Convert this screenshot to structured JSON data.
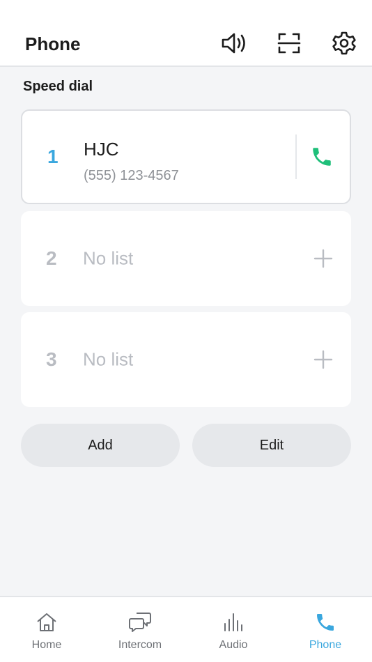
{
  "header": {
    "title": "Phone",
    "icons": [
      "speaker-icon",
      "scan-icon",
      "gear-icon"
    ]
  },
  "speed_dial": {
    "label": "Speed dial",
    "entries": [
      {
        "number": "1",
        "name": "HJC",
        "phone": "(555) 123-4567",
        "action_icon": "phone-icon"
      },
      {
        "number": "2",
        "empty_text": "No list",
        "action_icon": "plus-icon"
      },
      {
        "number": "3",
        "empty_text": "No list",
        "action_icon": "plus-icon"
      }
    ]
  },
  "actions": {
    "add_label": "Add",
    "edit_label": "Edit"
  },
  "bottom_nav": {
    "items": [
      {
        "label": "Home",
        "icon": "home-icon"
      },
      {
        "label": "Intercom",
        "icon": "chat-icon"
      },
      {
        "label": "Audio",
        "icon": "audio-bars-icon"
      },
      {
        "label": "Phone",
        "icon": "phone-icon",
        "active": true
      }
    ]
  },
  "colors": {
    "accent": "#3aa7de",
    "call_green": "#1fbf7a",
    "muted": "#b9bcc2",
    "background": "#f4f5f7"
  }
}
